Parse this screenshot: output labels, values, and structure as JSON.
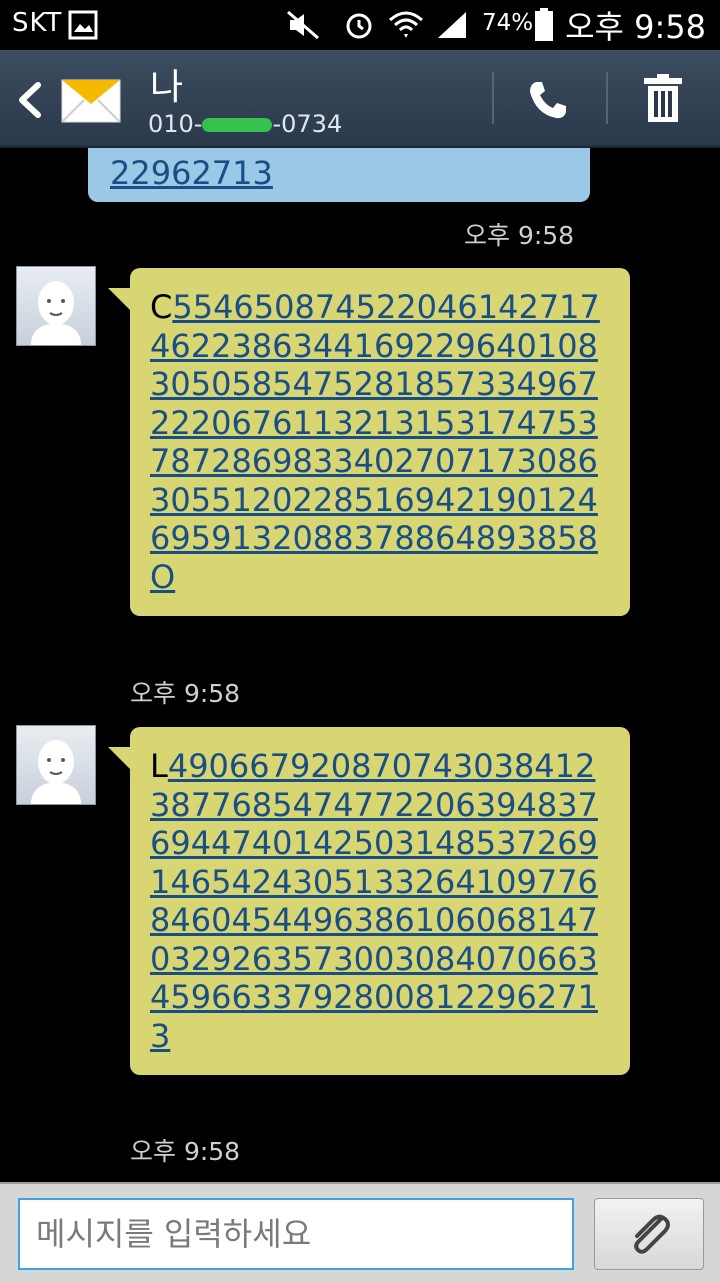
{
  "status_bar": {
    "carrier": "SKT",
    "battery": "74%",
    "time": "오후 9:58"
  },
  "header": {
    "contact_name": "나",
    "number_prefix": "010-",
    "number_suffix": "-0734"
  },
  "messages": [
    {
      "type": "sent",
      "text": "22962713",
      "time": "오후 9:58"
    },
    {
      "type": "received",
      "prefix": "C",
      "number": "554650874522046142717462238634416922964010830505854752818573349672220676113213153174753787286983340270717308630551202285169421901246959132088378864893858O",
      "time": "오후 9:58"
    },
    {
      "type": "received",
      "prefix": "L",
      "number": "490667920870743038412387768547477220639483769447401425031485372691465424305133264109776846045449638610606814703292635730030840706634596633792800812296271 3",
      "time": "오후 9:58"
    }
  ],
  "input": {
    "placeholder": "메시지를 입력하세요"
  },
  "icons": [
    "back-icon",
    "envelope-icon",
    "call-icon",
    "delete-icon",
    "attach-icon",
    "avatar-icon"
  ],
  "colors": {
    "header": "#33445a",
    "sent_bubble": "#9ac8e6",
    "received_bubble": "#d8d673",
    "link": "#1a4f86",
    "input_border": "#3aa5dc",
    "mask": "#36c24e"
  }
}
